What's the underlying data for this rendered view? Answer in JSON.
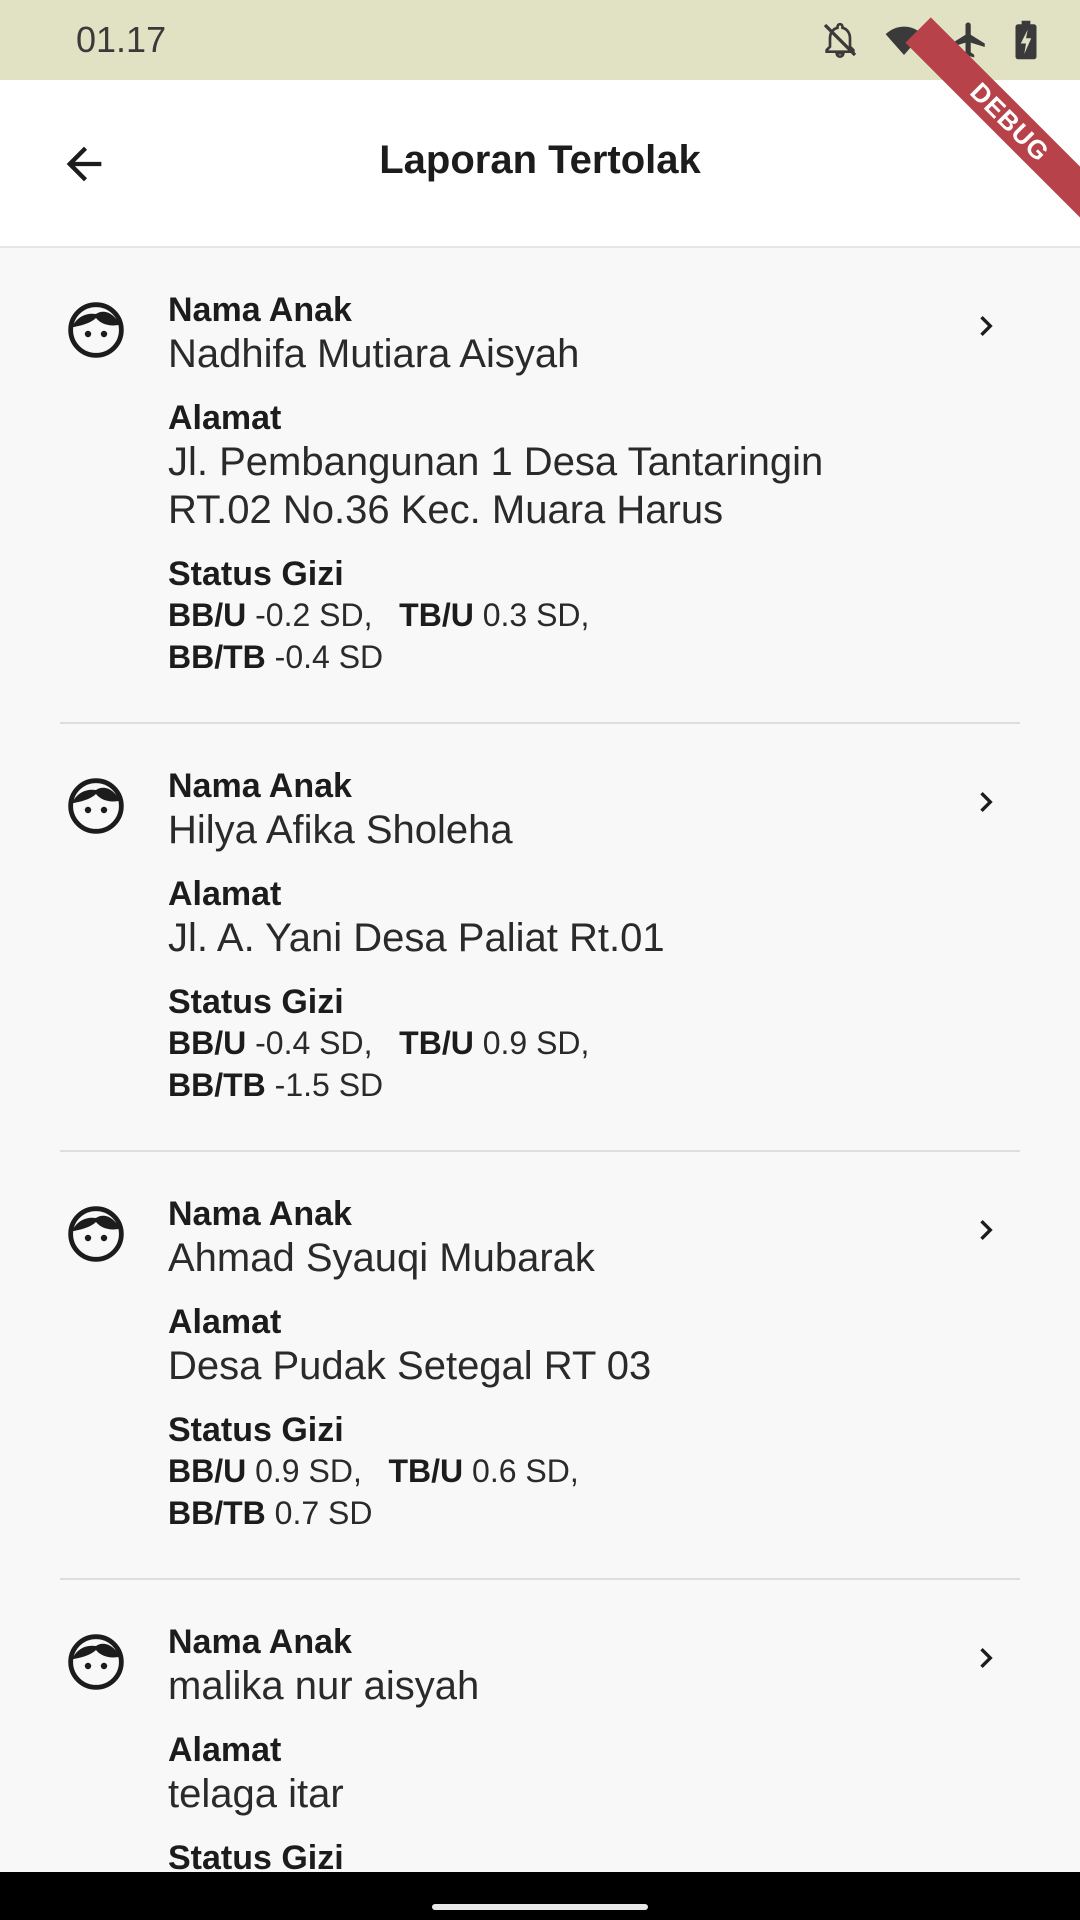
{
  "status_bar": {
    "time": "01.17",
    "icons": [
      "notifications-off-icon",
      "wifi-icon",
      "airplane-mode-icon",
      "battery-charging-icon"
    ]
  },
  "app_bar": {
    "title": "Laporan Tertolak",
    "back_icon": "arrow-back-icon",
    "debug_banner": "DEBUG"
  },
  "labels": {
    "nama": "Nama Anak",
    "alamat": "Alamat",
    "status": "Status Gizi",
    "bbu": "BB/U",
    "tbu": "TB/U",
    "bbtb": "BB/TB"
  },
  "reports": [
    {
      "nama": "Nadhifa Mutiara Aisyah",
      "alamat": "Jl. Pembangunan 1 Desa Tantaringin RT.02 No.36 Kec. Muara Harus",
      "bbu": "-0.2 SD,",
      "tbu": "0.3 SD,",
      "bbtb": "-0.4 SD"
    },
    {
      "nama": "Hilya Afika Sholeha",
      "alamat": "Jl. A. Yani Desa Paliat Rt.01",
      "bbu": "-0.4 SD,",
      "tbu": "0.9 SD,",
      "bbtb": "-1.5 SD"
    },
    {
      "nama": "Ahmad Syauqi Mubarak",
      "alamat": "Desa Pudak Setegal RT 03",
      "bbu": "0.9 SD,",
      "tbu": "0.6 SD,",
      "bbtb": "0.7 SD"
    },
    {
      "nama": "malika nur aisyah",
      "alamat": "telaga itar"
    }
  ],
  "colors": {
    "status_bar_bg": "#e1e1c4",
    "app_bar_bg": "#ffffff",
    "list_bg": "#f8f8f8",
    "debug_banner": "#b8424a",
    "nav_bar_bg": "#000000"
  }
}
